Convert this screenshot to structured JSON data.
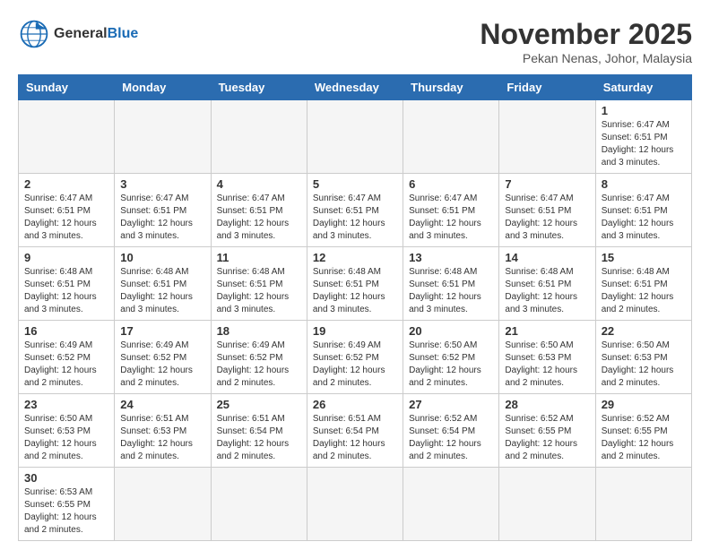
{
  "header": {
    "logo_general": "General",
    "logo_blue": "Blue",
    "month_title": "November 2025",
    "location": "Pekan Nenas, Johor, Malaysia"
  },
  "weekdays": [
    "Sunday",
    "Monday",
    "Tuesday",
    "Wednesday",
    "Thursday",
    "Friday",
    "Saturday"
  ],
  "weeks": [
    [
      {
        "day": "",
        "empty": true
      },
      {
        "day": "",
        "empty": true
      },
      {
        "day": "",
        "empty": true
      },
      {
        "day": "",
        "empty": true
      },
      {
        "day": "",
        "empty": true
      },
      {
        "day": "",
        "empty": true
      },
      {
        "day": "1",
        "sunrise": "6:47 AM",
        "sunset": "6:51 PM",
        "daylight": "12 hours and 3 minutes."
      }
    ],
    [
      {
        "day": "2",
        "sunrise": "6:47 AM",
        "sunset": "6:51 PM",
        "daylight": "12 hours and 3 minutes."
      },
      {
        "day": "3",
        "sunrise": "6:47 AM",
        "sunset": "6:51 PM",
        "daylight": "12 hours and 3 minutes."
      },
      {
        "day": "4",
        "sunrise": "6:47 AM",
        "sunset": "6:51 PM",
        "daylight": "12 hours and 3 minutes."
      },
      {
        "day": "5",
        "sunrise": "6:47 AM",
        "sunset": "6:51 PM",
        "daylight": "12 hours and 3 minutes."
      },
      {
        "day": "6",
        "sunrise": "6:47 AM",
        "sunset": "6:51 PM",
        "daylight": "12 hours and 3 minutes."
      },
      {
        "day": "7",
        "sunrise": "6:47 AM",
        "sunset": "6:51 PM",
        "daylight": "12 hours and 3 minutes."
      },
      {
        "day": "8",
        "sunrise": "6:47 AM",
        "sunset": "6:51 PM",
        "daylight": "12 hours and 3 minutes."
      }
    ],
    [
      {
        "day": "9",
        "sunrise": "6:48 AM",
        "sunset": "6:51 PM",
        "daylight": "12 hours and 3 minutes."
      },
      {
        "day": "10",
        "sunrise": "6:48 AM",
        "sunset": "6:51 PM",
        "daylight": "12 hours and 3 minutes."
      },
      {
        "day": "11",
        "sunrise": "6:48 AM",
        "sunset": "6:51 PM",
        "daylight": "12 hours and 3 minutes."
      },
      {
        "day": "12",
        "sunrise": "6:48 AM",
        "sunset": "6:51 PM",
        "daylight": "12 hours and 3 minutes."
      },
      {
        "day": "13",
        "sunrise": "6:48 AM",
        "sunset": "6:51 PM",
        "daylight": "12 hours and 3 minutes."
      },
      {
        "day": "14",
        "sunrise": "6:48 AM",
        "sunset": "6:51 PM",
        "daylight": "12 hours and 3 minutes."
      },
      {
        "day": "15",
        "sunrise": "6:48 AM",
        "sunset": "6:51 PM",
        "daylight": "12 hours and 2 minutes."
      }
    ],
    [
      {
        "day": "16",
        "sunrise": "6:49 AM",
        "sunset": "6:52 PM",
        "daylight": "12 hours and 2 minutes."
      },
      {
        "day": "17",
        "sunrise": "6:49 AM",
        "sunset": "6:52 PM",
        "daylight": "12 hours and 2 minutes."
      },
      {
        "day": "18",
        "sunrise": "6:49 AM",
        "sunset": "6:52 PM",
        "daylight": "12 hours and 2 minutes."
      },
      {
        "day": "19",
        "sunrise": "6:49 AM",
        "sunset": "6:52 PM",
        "daylight": "12 hours and 2 minutes."
      },
      {
        "day": "20",
        "sunrise": "6:50 AM",
        "sunset": "6:52 PM",
        "daylight": "12 hours and 2 minutes."
      },
      {
        "day": "21",
        "sunrise": "6:50 AM",
        "sunset": "6:53 PM",
        "daylight": "12 hours and 2 minutes."
      },
      {
        "day": "22",
        "sunrise": "6:50 AM",
        "sunset": "6:53 PM",
        "daylight": "12 hours and 2 minutes."
      }
    ],
    [
      {
        "day": "23",
        "sunrise": "6:50 AM",
        "sunset": "6:53 PM",
        "daylight": "12 hours and 2 minutes."
      },
      {
        "day": "24",
        "sunrise": "6:51 AM",
        "sunset": "6:53 PM",
        "daylight": "12 hours and 2 minutes."
      },
      {
        "day": "25",
        "sunrise": "6:51 AM",
        "sunset": "6:54 PM",
        "daylight": "12 hours and 2 minutes."
      },
      {
        "day": "26",
        "sunrise": "6:51 AM",
        "sunset": "6:54 PM",
        "daylight": "12 hours and 2 minutes."
      },
      {
        "day": "27",
        "sunrise": "6:52 AM",
        "sunset": "6:54 PM",
        "daylight": "12 hours and 2 minutes."
      },
      {
        "day": "28",
        "sunrise": "6:52 AM",
        "sunset": "6:55 PM",
        "daylight": "12 hours and 2 minutes."
      },
      {
        "day": "29",
        "sunrise": "6:52 AM",
        "sunset": "6:55 PM",
        "daylight": "12 hours and 2 minutes."
      }
    ],
    [
      {
        "day": "30",
        "sunrise": "6:53 AM",
        "sunset": "6:55 PM",
        "daylight": "12 hours and 2 minutes."
      },
      {
        "day": "",
        "empty": true
      },
      {
        "day": "",
        "empty": true
      },
      {
        "day": "",
        "empty": true
      },
      {
        "day": "",
        "empty": true
      },
      {
        "day": "",
        "empty": true
      },
      {
        "day": "",
        "empty": true
      }
    ]
  ]
}
